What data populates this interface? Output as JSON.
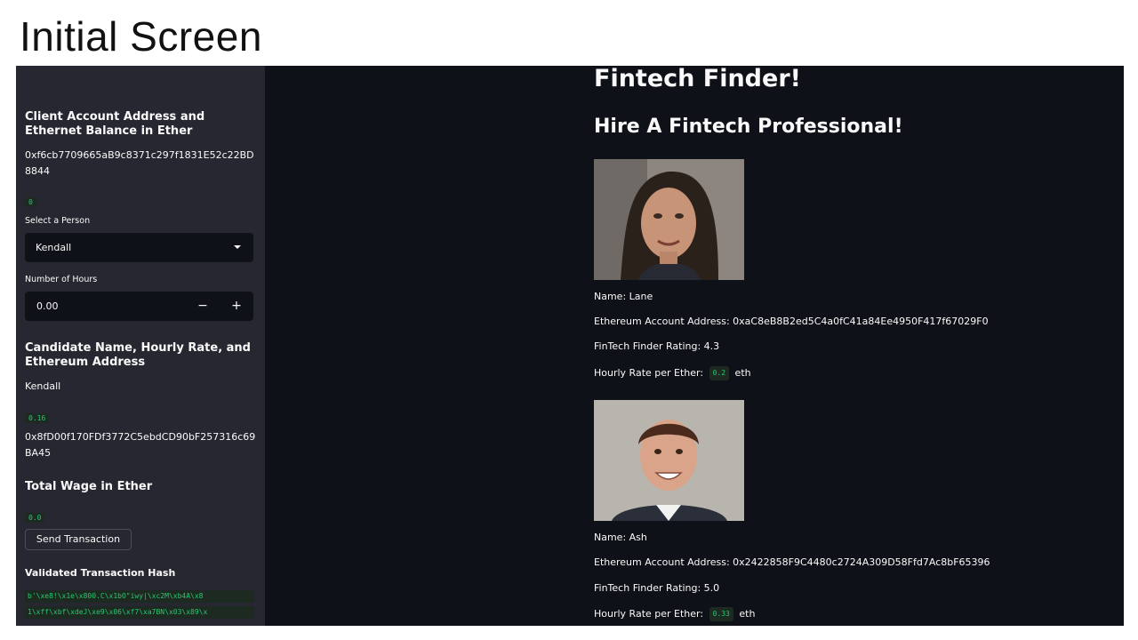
{
  "slide": {
    "title": "Initial Screen"
  },
  "sidebar": {
    "client_heading": "Client Account Address and Ethernet Balance in Ether",
    "client_address_line1": "0xf6cb7709665aB9c8371c297f1831E52c22BD",
    "client_address_line2": "8844",
    "client_balance": "0",
    "select_label": "Select a Person",
    "select_value": "Kendall",
    "hours_label": "Number of Hours",
    "hours_value": "0.00",
    "minus_label": "−",
    "plus_label": "+",
    "candidate_heading": "Candidate Name, Hourly Rate, and Ethereum Address",
    "candidate_name": "Kendall",
    "candidate_rate": "0.16",
    "candidate_address_line1": "0x8fD00f170FDf3772C5ebdCD90bF257316c69",
    "candidate_address_line2": "BA45",
    "total_wage_heading": "Total Wage in Ether",
    "total_wage_value": "0.0",
    "send_button": "Send Transaction",
    "validated_heading": "Validated Transaction Hash",
    "hash_line1": "b'\\xe8!\\x1e\\x800.C\\x1bO\"iwy|\\xc2M\\xb4A\\x8",
    "hash_line2": "1\\xff\\xbf\\xdeJ\\xe9\\x06\\xf7\\xa7BN\\x03\\x89\\x"
  },
  "main": {
    "title": "Fintech Finder!",
    "subtitle": "Hire A Fintech Professional!",
    "candidates": [
      {
        "name": "Name: Lane",
        "address": "Ethereum Account Address: 0xaC8eB8B2ed5C4a0fC41a84Ee4950F417f67029F0",
        "rating": "FinTech Finder Rating: 4.3",
        "rate_label": "Hourly Rate per Ether:",
        "rate_value": "0.2",
        "rate_unit": "eth"
      },
      {
        "name": "Name: Ash",
        "address": "Ethereum Account Address: 0x2422858F9C4480c2724A309D58Ffd7Ac8bF65396",
        "rating": "FinTech Finder Rating: 5.0",
        "rate_label": "Hourly Rate per Ether:",
        "rate_value": "0.33",
        "rate_unit": "eth"
      }
    ]
  },
  "colors": {
    "app_bg": "#0e1117",
    "sidebar_bg": "#262730",
    "code_green": "#28c76f",
    "text": "#fafafa"
  },
  "icons": [
    "chevron-down-icon",
    "minus-icon",
    "plus-icon"
  ]
}
